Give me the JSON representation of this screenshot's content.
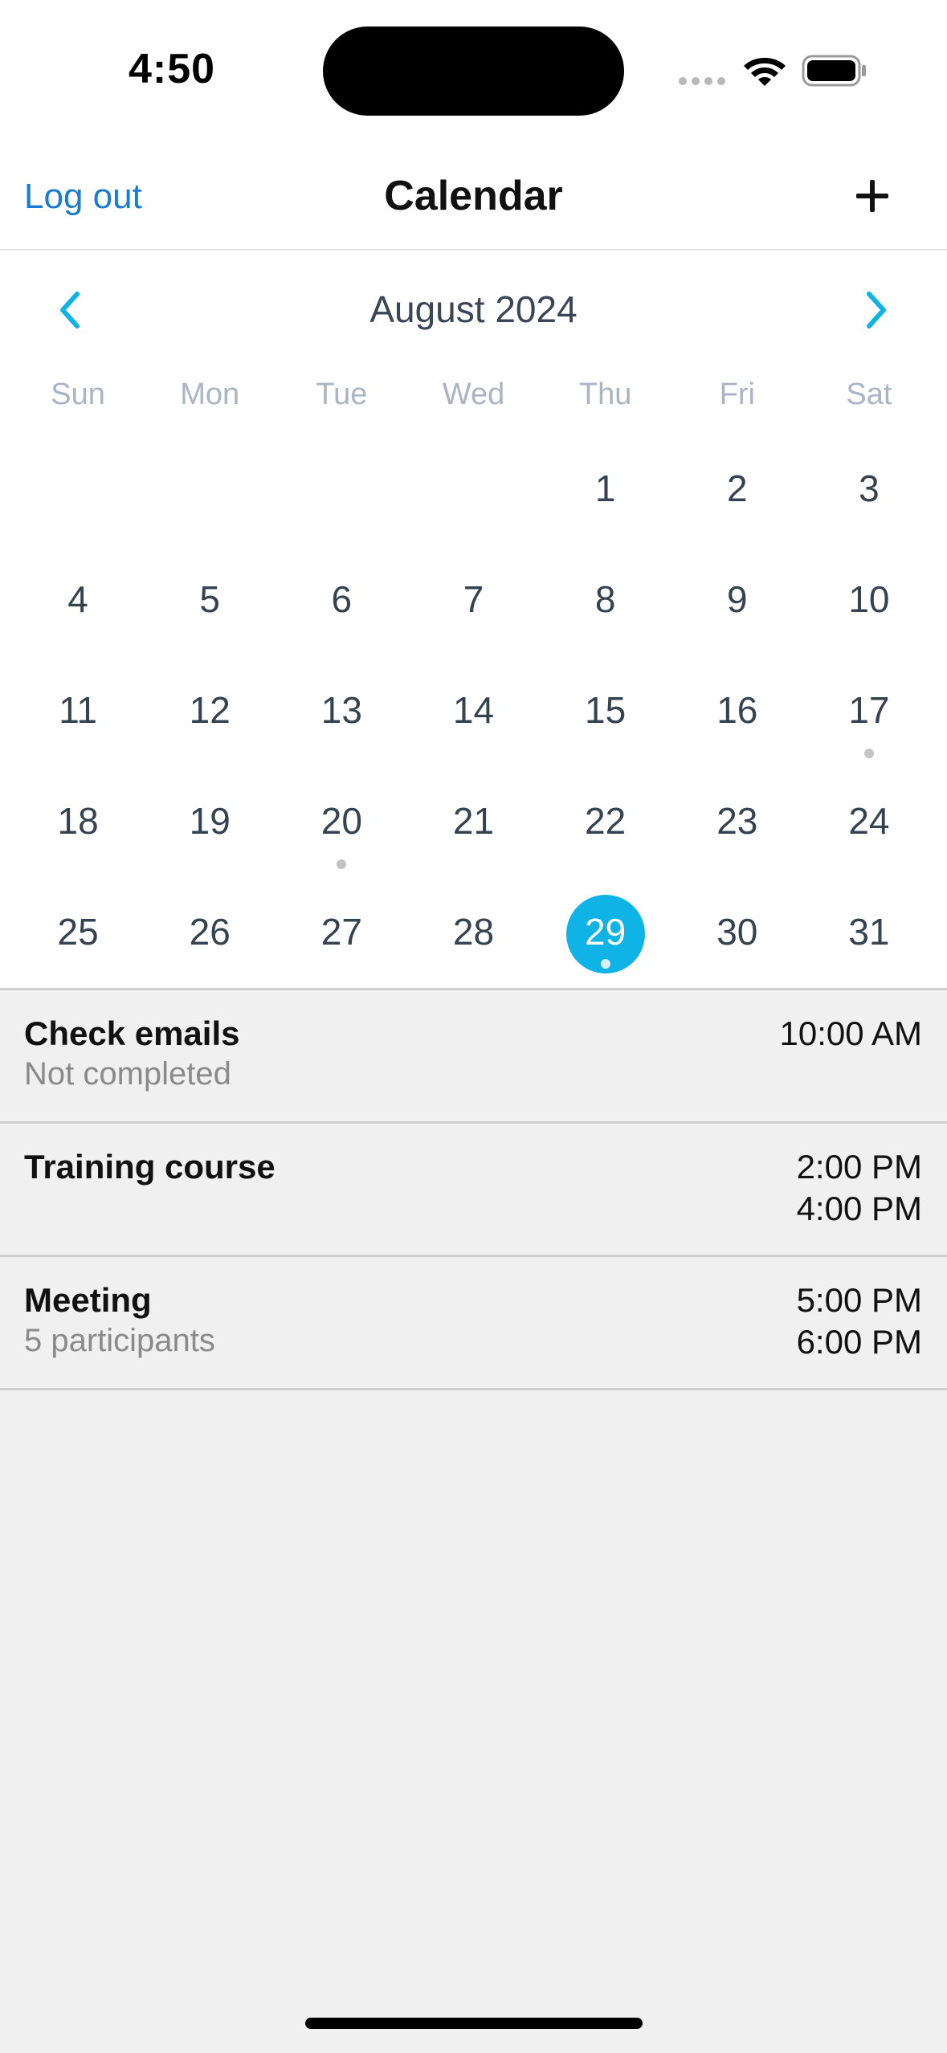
{
  "status": {
    "time": "4:50"
  },
  "nav": {
    "logout_label": "Log out",
    "title": "Calendar",
    "add_icon": "plus-icon"
  },
  "calendar": {
    "month_label": "August 2024",
    "prev_icon": "chevron-left-icon",
    "next_icon": "chevron-right-icon",
    "accent_color": "#0fb3e6",
    "weekdays": [
      "Sun",
      "Mon",
      "Tue",
      "Wed",
      "Thu",
      "Fri",
      "Sat"
    ],
    "days": [
      "",
      "",
      "",
      "",
      "1",
      "2",
      "3",
      "4",
      "5",
      "6",
      "7",
      "8",
      "9",
      "10",
      "11",
      "12",
      "13",
      "14",
      "15",
      "16",
      "17",
      "18",
      "19",
      "20",
      "21",
      "22",
      "23",
      "24",
      "25",
      "26",
      "27",
      "28",
      "29",
      "30",
      "31"
    ],
    "selected_day": "29",
    "days_with_events": [
      "17",
      "20",
      "29"
    ]
  },
  "events": [
    {
      "title": "Check emails",
      "subtitle": "Not completed",
      "time_start": "10:00 AM",
      "time_end": ""
    },
    {
      "title": "Training course",
      "subtitle": "",
      "time_start": "2:00 PM",
      "time_end": "4:00 PM"
    },
    {
      "title": "Meeting",
      "subtitle": "5 participants",
      "time_start": "5:00 PM",
      "time_end": "6:00 PM"
    }
  ]
}
